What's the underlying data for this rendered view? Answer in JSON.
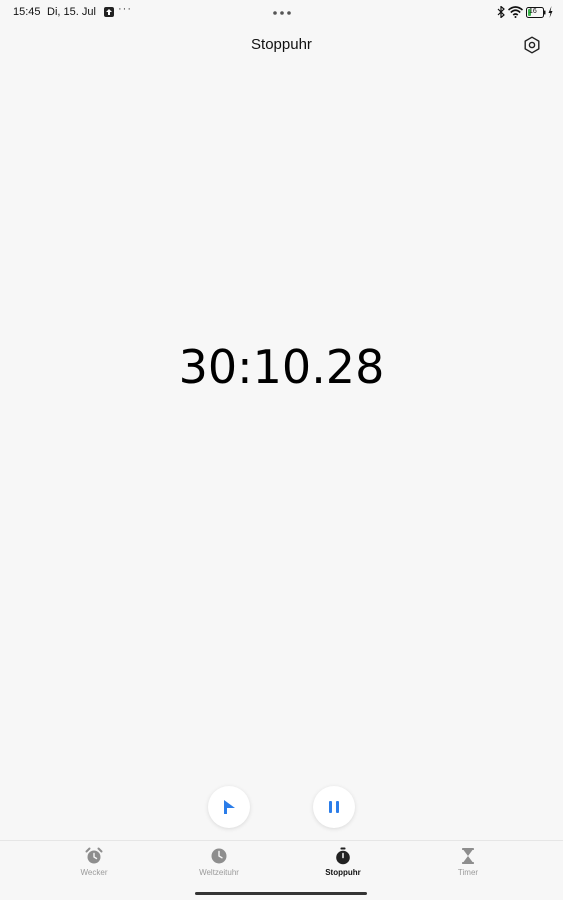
{
  "status_bar": {
    "time": "15:45",
    "date": "Di, 15. Jul",
    "more": "···",
    "battery_level": "16",
    "icons": [
      "notification-app-icon",
      "bluetooth-icon",
      "wifi-icon",
      "battery-icon",
      "charging-icon"
    ]
  },
  "header": {
    "title": "Stoppuhr",
    "settings_icon": "settings-hexagon-icon"
  },
  "stopwatch": {
    "elapsed": "30:10.28"
  },
  "controls": {
    "lap_icon": "flag-icon",
    "pause_icon": "pause-icon",
    "accent_color": "#2b7de9"
  },
  "bottom_nav": {
    "items": [
      {
        "label": "Wecker",
        "icon": "alarm-clock-icon",
        "active": false
      },
      {
        "label": "Weltzeituhr",
        "icon": "clock-icon",
        "active": false
      },
      {
        "label": "Stoppuhr",
        "icon": "stopwatch-icon",
        "active": true
      },
      {
        "label": "Timer",
        "icon": "hourglass-icon",
        "active": false
      }
    ]
  }
}
